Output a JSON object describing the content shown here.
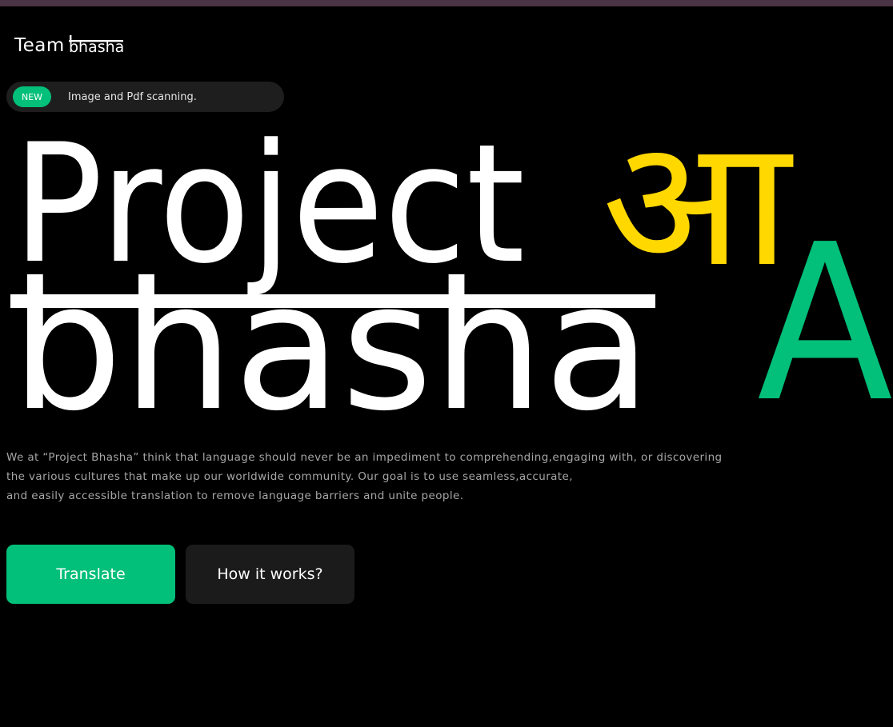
{
  "top_strip_color": "#4a3344",
  "brand": {
    "team": "Team",
    "bhasha": "bhasha"
  },
  "announcement": {
    "badge": "NEW",
    "text": "Image and Pdf scanning."
  },
  "hero": {
    "line1": "Project",
    "line2": "bhasha",
    "devanagari_letter": "आ",
    "latin_letter": "A",
    "colors": {
      "primary": "#ffffff",
      "devanagari": "#ffd800",
      "latin": "#02bf79"
    }
  },
  "description": {
    "line1": "We at “Project Bhasha” think that language should never be an impediment to comprehending,engaging with, or discovering",
    "line2": "the various cultures that make up our worldwide community. Our goal is to use seamless,accurate,",
    "line3": "and easily accessible translation to remove language barriers and unite people."
  },
  "buttons": {
    "translate": "Translate",
    "how_it_works": "How it works?"
  },
  "colors": {
    "accent_green": "#02bf79",
    "background": "#000000",
    "button_dark": "#1b1b1b"
  }
}
